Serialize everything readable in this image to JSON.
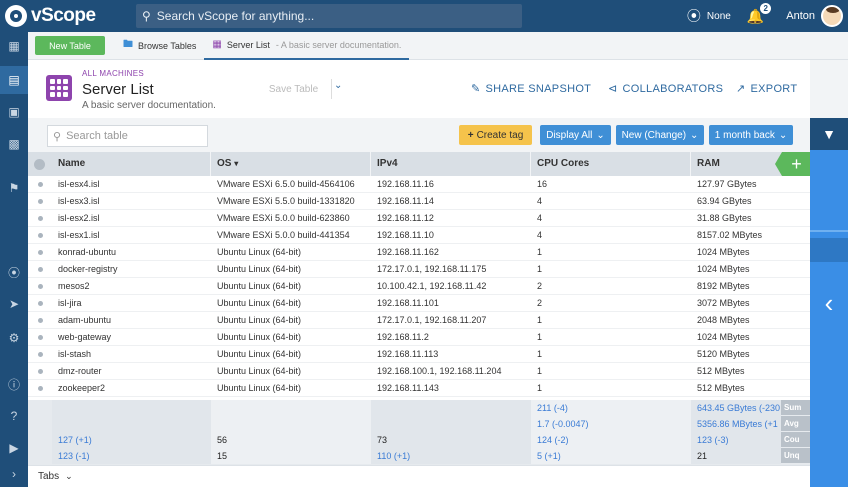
{
  "app": {
    "name": "vScope"
  },
  "topbar": {
    "search_placeholder": "Search vScope for anything...",
    "status_label": "None",
    "notifications_count": "2",
    "user_name": "Anton"
  },
  "tabsrow": {
    "new_table_label": "New Table",
    "browse_tables_label": "Browse Tables",
    "server_list_label": "Server List",
    "server_list_sub": "-  A basic server documentation."
  },
  "header": {
    "breadcrumb": "ALL MACHINES",
    "title": "Server List",
    "subtitle": "A basic server documentation.",
    "save_table_label": "Save Table",
    "share_label": "SHARE SNAPSHOT",
    "collaborators_label": "COLLABORATORS",
    "export_label": "EXPORT"
  },
  "toolbar": {
    "search_placeholder": "Search table",
    "create_tag_label": "Create tag",
    "display_all_label": "Display All",
    "new_change_label": "New (Change)",
    "time_label": "1 month back"
  },
  "table": {
    "columns": [
      "Name",
      "OS",
      "IPv4",
      "CPU Cores",
      "RAM"
    ],
    "rows": [
      [
        "isl-esx4.isl",
        "VMware ESXi 6.5.0 build-4564106",
        "192.168.11.16",
        "16",
        "127.97 GBytes"
      ],
      [
        "isl-esx3.isl",
        "VMware ESXi 5.5.0 build-1331820",
        "192.168.11.14",
        "4",
        "63.94 GBytes"
      ],
      [
        "isl-esx2.isl",
        "VMware ESXi 5.0.0 build-623860",
        "192.168.11.12",
        "4",
        "31.88 GBytes"
      ],
      [
        "isl-esx1.isl",
        "VMware ESXi 5.0.0 build-441354",
        "192.168.11.10",
        "4",
        "8157.02 MBytes"
      ],
      [
        "konrad-ubuntu",
        "Ubuntu Linux (64-bit)",
        "192.168.11.162",
        "1",
        "1024 MBytes"
      ],
      [
        "docker-registry",
        "Ubuntu Linux (64-bit)",
        "172.17.0.1, 192.168.11.175",
        "1",
        "1024 MBytes"
      ],
      [
        "mesos2",
        "Ubuntu Linux (64-bit)",
        "10.100.42.1, 192.168.11.42",
        "2",
        "8192 MBytes"
      ],
      [
        "isl-jira",
        "Ubuntu Linux (64-bit)",
        "192.168.11.101",
        "2",
        "3072 MBytes"
      ],
      [
        "adam-ubuntu",
        "Ubuntu Linux (64-bit)",
        "172.17.0.1, 192.168.11.207",
        "1",
        "2048 MBytes"
      ],
      [
        "web-gateway",
        "Ubuntu Linux (64-bit)",
        "192.168.11.2",
        "1",
        "1024 MBytes"
      ],
      [
        "isl-stash",
        "Ubuntu Linux (64-bit)",
        "192.168.11.113",
        "1",
        "5120 MBytes"
      ],
      [
        "dmz-router",
        "Ubuntu Linux (64-bit)",
        "192.168.100.1, 192.168.11.204",
        "1",
        "512 MBytes"
      ],
      [
        "zookeeper2",
        "Ubuntu Linux (64-bit)",
        "192.168.11.143",
        "1",
        "512 MBytes"
      ]
    ],
    "summary": [
      {
        "tag": "Sum",
        "cells": [
          "",
          "",
          "",
          "211 (-4)",
          "643.45 GBytes (-230"
        ]
      },
      {
        "tag": "Avg",
        "cells": [
          "",
          "",
          "",
          "1.7 (-0.0047)",
          "5356.86 MBytes (+1"
        ]
      },
      {
        "tag": "Cou",
        "cells": [
          "127 (+1)",
          "56",
          "73",
          "124 (-2)",
          "123 (-3)"
        ]
      },
      {
        "tag": "Unq",
        "cells": [
          "123 (-1)",
          "15",
          "110 (+1)",
          "5 (+1)",
          "21"
        ]
      }
    ]
  },
  "bottombar": {
    "tabs_label": "Tabs"
  },
  "colors": {
    "navy": "#1f4e79",
    "blue": "#3a8ee6",
    "green": "#5cb85c",
    "purple": "#8e44ad",
    "orange": "#f5c34b"
  }
}
